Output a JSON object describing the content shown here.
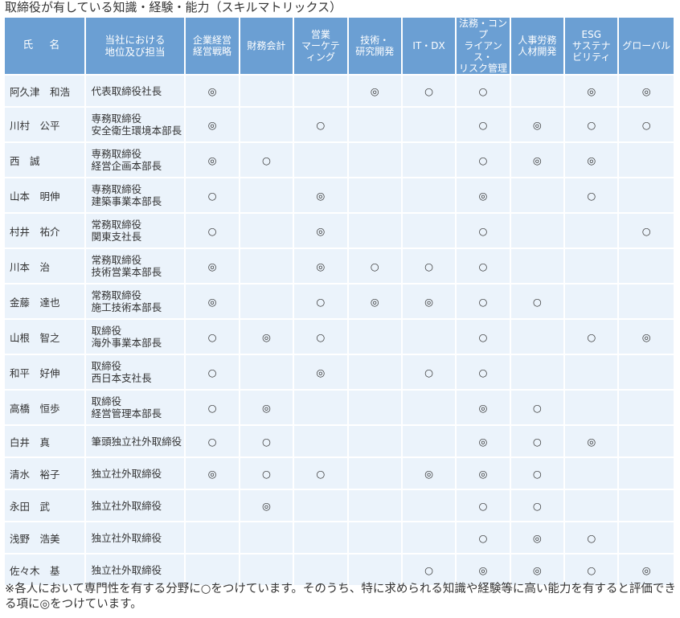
{
  "title": "取締役が有している知識・経験・能力（スキルマトリックス）",
  "headers": {
    "name": "氏 名",
    "position": "当社における\n地位及び担当",
    "skills": [
      "企業経営\n経営戦略",
      "財務会計",
      "営業\nマーケテ\nィング",
      "技術・\n研究開発",
      "IT・DX",
      "法務・コンプ\nライアンス・\nリスク管理",
      "人事労務\n人材開発",
      "ESG\nサステナ\nビリティ",
      "グローバル"
    ]
  },
  "rows": [
    {
      "name": "阿久津　和浩",
      "position": "代表取締役社長",
      "marks": [
        "◎",
        "",
        "",
        "◎",
        "○",
        "○",
        "",
        "◎",
        "◎"
      ]
    },
    {
      "name": "川村　公平",
      "position": "専務取締役\n安全衛生環境本部長",
      "marks": [
        "◎",
        "",
        "○",
        "",
        "",
        "○",
        "◎",
        "○",
        "○"
      ]
    },
    {
      "name": "西　誠",
      "position": "専務取締役\n経営企画本部長",
      "marks": [
        "◎",
        "○",
        "",
        "",
        "",
        "○",
        "◎",
        "◎",
        ""
      ]
    },
    {
      "name": "山本　明伸",
      "position": "専務取締役\n建築事業本部長",
      "marks": [
        "○",
        "",
        "◎",
        "",
        "",
        "◎",
        "",
        "○",
        ""
      ]
    },
    {
      "name": "村井　祐介",
      "position": "常務取締役\n関東支社長",
      "marks": [
        "○",
        "",
        "◎",
        "",
        "",
        "○",
        "",
        "",
        "○"
      ]
    },
    {
      "name": "川本　治",
      "position": "常務取締役\n技術営業本部長",
      "marks": [
        "◎",
        "",
        "◎",
        "○",
        "○",
        "○",
        "",
        "",
        ""
      ]
    },
    {
      "name": "金藤　達也",
      "position": "常務取締役\n施工技術本部長",
      "marks": [
        "◎",
        "",
        "○",
        "◎",
        "◎",
        "○",
        "○",
        "",
        ""
      ]
    },
    {
      "name": "山根　智之",
      "position": "取締役\n海外事業本部長",
      "marks": [
        "○",
        "◎",
        "○",
        "",
        "",
        "○",
        "",
        "○",
        "◎"
      ]
    },
    {
      "name": "和平　好伸",
      "position": "取締役\n西日本支社長",
      "marks": [
        "○",
        "",
        "◎",
        "",
        "○",
        "○",
        "",
        "",
        ""
      ]
    },
    {
      "name": "高橋　恒歩",
      "position": "取締役\n経営管理本部長",
      "marks": [
        "○",
        "◎",
        "",
        "",
        "",
        "◎",
        "○",
        "",
        ""
      ]
    },
    {
      "name": "白井　真",
      "position": "筆頭独立社外取締役",
      "marks": [
        "○",
        "○",
        "",
        "",
        "",
        "◎",
        "○",
        "◎",
        ""
      ]
    },
    {
      "name": "清水　裕子",
      "position": "独立社外取締役",
      "marks": [
        "◎",
        "○",
        "○",
        "",
        "◎",
        "◎",
        "○",
        "",
        ""
      ]
    },
    {
      "name": "永田　武",
      "position": "独立社外取締役",
      "marks": [
        "",
        "◎",
        "",
        "",
        "",
        "○",
        "○",
        "",
        ""
      ]
    },
    {
      "name": "浅野　浩美",
      "position": "独立社外取締役",
      "marks": [
        "",
        "",
        "",
        "",
        "",
        "○",
        "◎",
        "○",
        ""
      ]
    },
    {
      "name": "佐々木　基",
      "position": "独立社外取締役",
      "marks": [
        "",
        "",
        "",
        "",
        "○",
        "◎",
        "◎",
        "○",
        "◎"
      ]
    }
  ],
  "note": "※各人において専門性を有する分野に○をつけています。そのうち、特に求められる知識や経験等に高い能力を有すると評価できる項に◎をつけています。"
}
